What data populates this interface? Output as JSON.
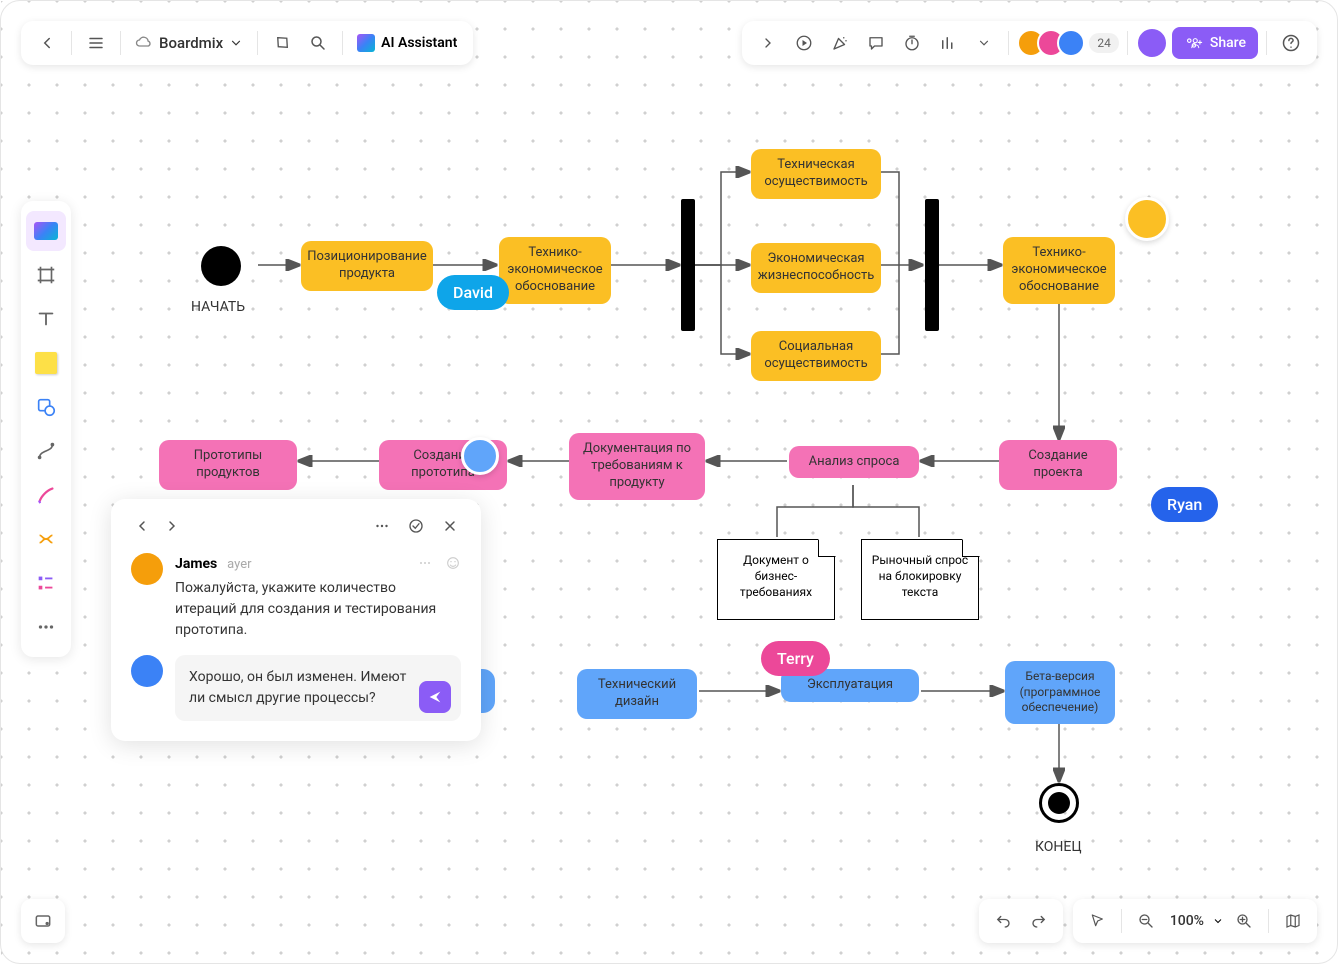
{
  "header": {
    "file_name": "Boardmix",
    "ai_label": "AI Assistant",
    "avatar_count": "24",
    "share_label": "Share"
  },
  "zoom": {
    "value": "100%"
  },
  "nodes": {
    "start_label": "НАЧАТЬ",
    "end_label": "КОНЕЦ",
    "n1": "Позиционирование продукта",
    "n2": "Технико-экономическое обоснование",
    "n3": "Техническая осуществимость",
    "n4": "Экономическая жизнеспособность",
    "n5": "Социальная осуществимость",
    "n6": "Технико-экономическое обоснование",
    "p1": "Создание проекта",
    "p2": "Анализ спроса",
    "p3": "Документация по требованиям к продукту",
    "p4": "Создание прототипа",
    "p5": "Прототипы продуктов",
    "d1": "Документ о бизнес-требованиях",
    "d2": "Рыночный спрос на блокировку текста",
    "b1": "Технический дизайн",
    "b2": "Эксплуатация",
    "b3": "Бета-версия (программное обеспечение)"
  },
  "cursors": {
    "david": "David",
    "ryan": "Ryan",
    "terry": "Terry"
  },
  "comments": {
    "user1": "James",
    "time1": "ayer",
    "text1": "Пожалуйста, укажите количество итераций для создания и тестирования прототипа.",
    "reply": "Хорошо, он был изменен. Имеют ли смысл другие процессы?"
  },
  "avatars": {
    "a1": "#f59e0b",
    "a2": "#ec4899",
    "a3": "#3b82f6",
    "float1": "#fbbf24",
    "float2": "#60a5fa",
    "james": "#f59e0b",
    "me": "#3b82f6"
  }
}
